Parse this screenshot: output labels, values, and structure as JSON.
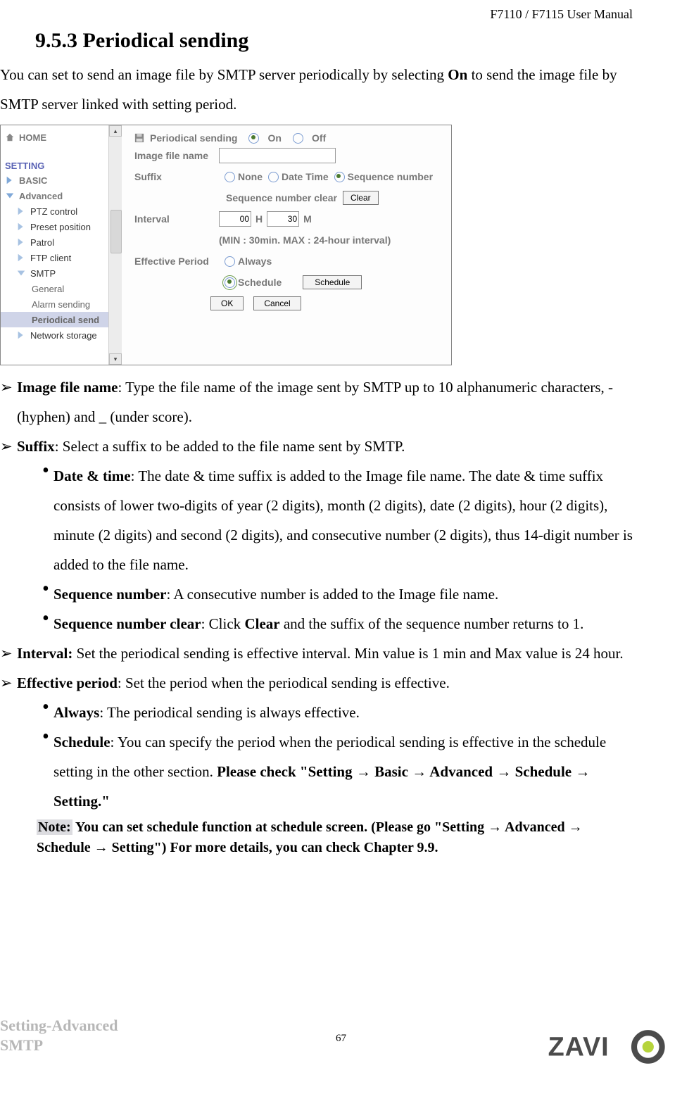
{
  "header": {
    "product": "F7110 / F7115 User Manual"
  },
  "section": {
    "number": "9.5.3",
    "title": "Periodical sending"
  },
  "intro": {
    "pre": "You can set to send an image file by SMTP server periodically by selecting ",
    "bold": "On",
    "post": " to send the image file by SMTP server linked with setting period."
  },
  "nav": {
    "home": "HOME",
    "setting": "SETTING",
    "basic": "BASIC",
    "advanced": "Advanced",
    "items": {
      "ptz": "PTZ control",
      "preset": "Preset position",
      "patrol": "Patrol",
      "ftp": "FTP client",
      "smtp": "SMTP",
      "general": "General",
      "alarm": "Alarm sending",
      "periodical": "Periodical send",
      "network": "Network storage"
    }
  },
  "form": {
    "ps_label": "Periodical sending",
    "on": "On",
    "off": "Off",
    "img_label": "Image file name",
    "img_value": "",
    "suffix_label": "Suffix",
    "suffix_none": "None",
    "suffix_dt": "Date Time",
    "suffix_seq": "Sequence number",
    "seq_clear_label": "Sequence number clear",
    "clear_btn": "Clear",
    "interval_label": "Interval",
    "interval_h": "00",
    "h_unit": "H",
    "interval_m": "30",
    "m_unit": "M",
    "interval_hint": "(MIN : 30min. MAX : 24-hour interval)",
    "eff_label": "Effective Period",
    "always": "Always",
    "schedule": "Schedule",
    "schedule_btn": "Schedule",
    "ok": "OK",
    "cancel": "Cancel"
  },
  "bul": {
    "img_b": "Image file name",
    "img_t": ": Type the file name of the image sent by SMTP up to 10 alphanumeric characters, - (hyphen) and _ (under score).",
    "suf_b": "Suffix",
    "suf_t": ": Select a suffix to be added to the file name sent by SMTP.",
    "dt_b": "Date & time",
    "dt_t": ": The date & time suffix is added to the Image file name. The date & time suffix consists of lower two-digits of year (2 digits), month (2 digits), date (2 digits), hour (2 digits), minute (2 digits) and second (2 digits), and consecutive number (2 digits), thus 14-digit number is added to the file name.",
    "seq_b": "Sequence number",
    "seq_t": ": A consecutive number is added to the Image file name.",
    "seqc_b": "Sequence number clear",
    "seqc_t1": ": Click ",
    "seqc_bold": "Clear",
    "seqc_t2": " and the suffix of the sequence number returns to 1.",
    "int_b": "Interval:",
    "int_t": " Set the periodical sending is effective interval. Min value is 1 min and Max value is 24 hour.",
    "eff_b": "Effective period",
    "eff_t": ": Set the period when the periodical sending is effective.",
    "alw_b": "Always",
    "alw_t": ": The periodical sending is always effective.",
    "sch_b": "Schedule",
    "sch_t1": ": You can specify the period when the periodical sending is effective in the schedule setting in the other section. ",
    "sch_bold": "Please check \"Setting → Basic → Advanced → Schedule → Setting.\""
  },
  "note": {
    "label": "Note:",
    "text": " You can set schedule function at schedule screen. (Please go \"Setting → Advanced → Schedule → Setting\") For more details, you can check Chapter 9.9."
  },
  "footer": {
    "section_path": "Setting-Advanced\nSMTP",
    "page": "67"
  }
}
